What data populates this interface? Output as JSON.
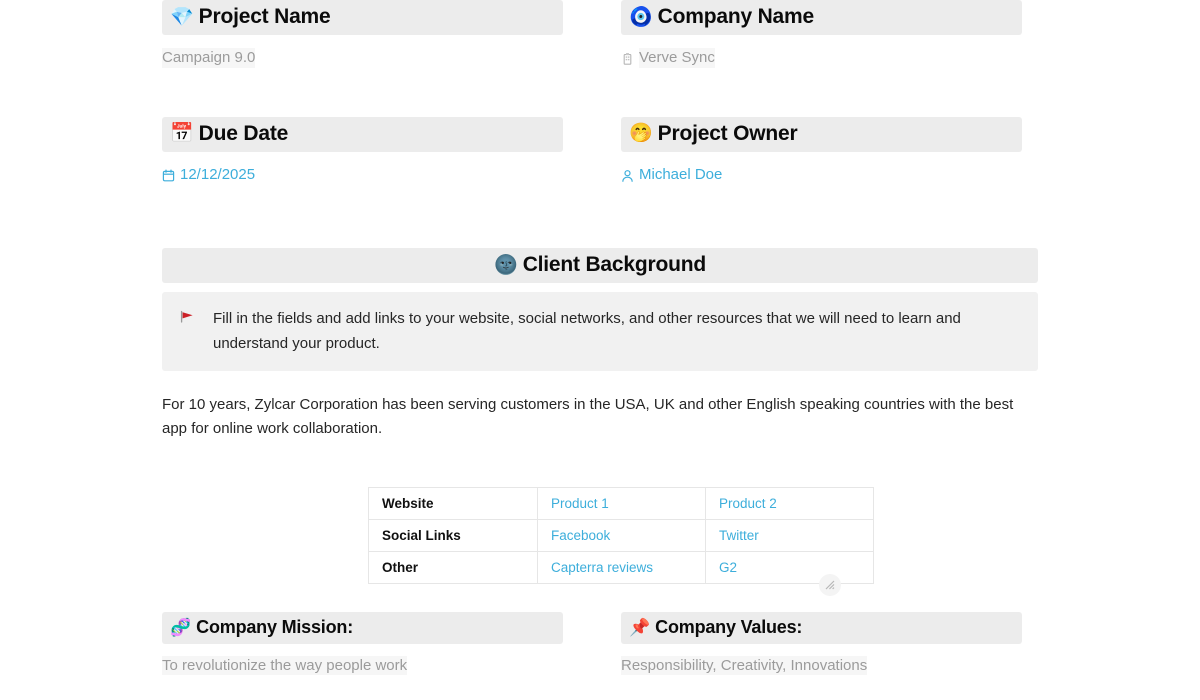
{
  "fields": {
    "project_name": {
      "emoji": "💎",
      "emoji_name": "gem-stone-emoji",
      "label": "Project Name",
      "value": "Campaign 9.0",
      "value_style": "placeholder"
    },
    "company_name": {
      "emoji": "🧿",
      "emoji_name": "nazar-amulet-emoji",
      "label": "Company Name",
      "value": "Verve Sync",
      "value_style": "placeholder",
      "value_icon": "office-building-icon"
    },
    "due_date": {
      "emoji": "📅",
      "emoji_name": "calendar-emoji",
      "label": "Due Date",
      "value": "12/12/2025",
      "value_style": "link",
      "value_icon": "calendar-icon"
    },
    "project_owner": {
      "emoji": "🤭",
      "emoji_name": "smiling-face-emoji",
      "label": "Project Owner",
      "value": "Michael Doe",
      "value_style": "link",
      "value_icon": "person-icon"
    }
  },
  "client_background": {
    "emoji": "🌚",
    "emoji_name": "new-moon-face-emoji",
    "title": "Client Background",
    "callout": {
      "marker": "🚩",
      "marker_name": "red-flag-icon",
      "text": "Fill in the fields and add links to your website, social networks, and other resources that we will need to learn and understand your product."
    },
    "paragraph": "For 10 years, Zylcar Corporation has been serving customers in the USA, UK and other English speaking countries with the best app for online work collaboration."
  },
  "links_table": {
    "rows": [
      {
        "label": "Website",
        "link1": "Product 1",
        "link2": "Product 2"
      },
      {
        "label": "Social Links",
        "link1": "Facebook",
        "link2": "Twitter"
      },
      {
        "label": "Other",
        "link1": "Capterra reviews",
        "link2": "G2"
      }
    ]
  },
  "company_mission": {
    "emoji": "🧬",
    "emoji_name": "dna-emoji",
    "label": "Company Mission:",
    "value": "To revolutionize the way people work"
  },
  "company_values": {
    "emoji": "📌",
    "emoji_name": "pushpin-emoji",
    "label": "Company Values:",
    "value": "Responsibility, Creativity, Innovations"
  },
  "colors": {
    "band_bg": "#ececec",
    "callout_bg": "#f1f1f1",
    "link": "#3daedb",
    "placeholder_text": "#9b9b9b",
    "table_border": "#e6e6e6",
    "flag_red": "#cc2127"
  }
}
